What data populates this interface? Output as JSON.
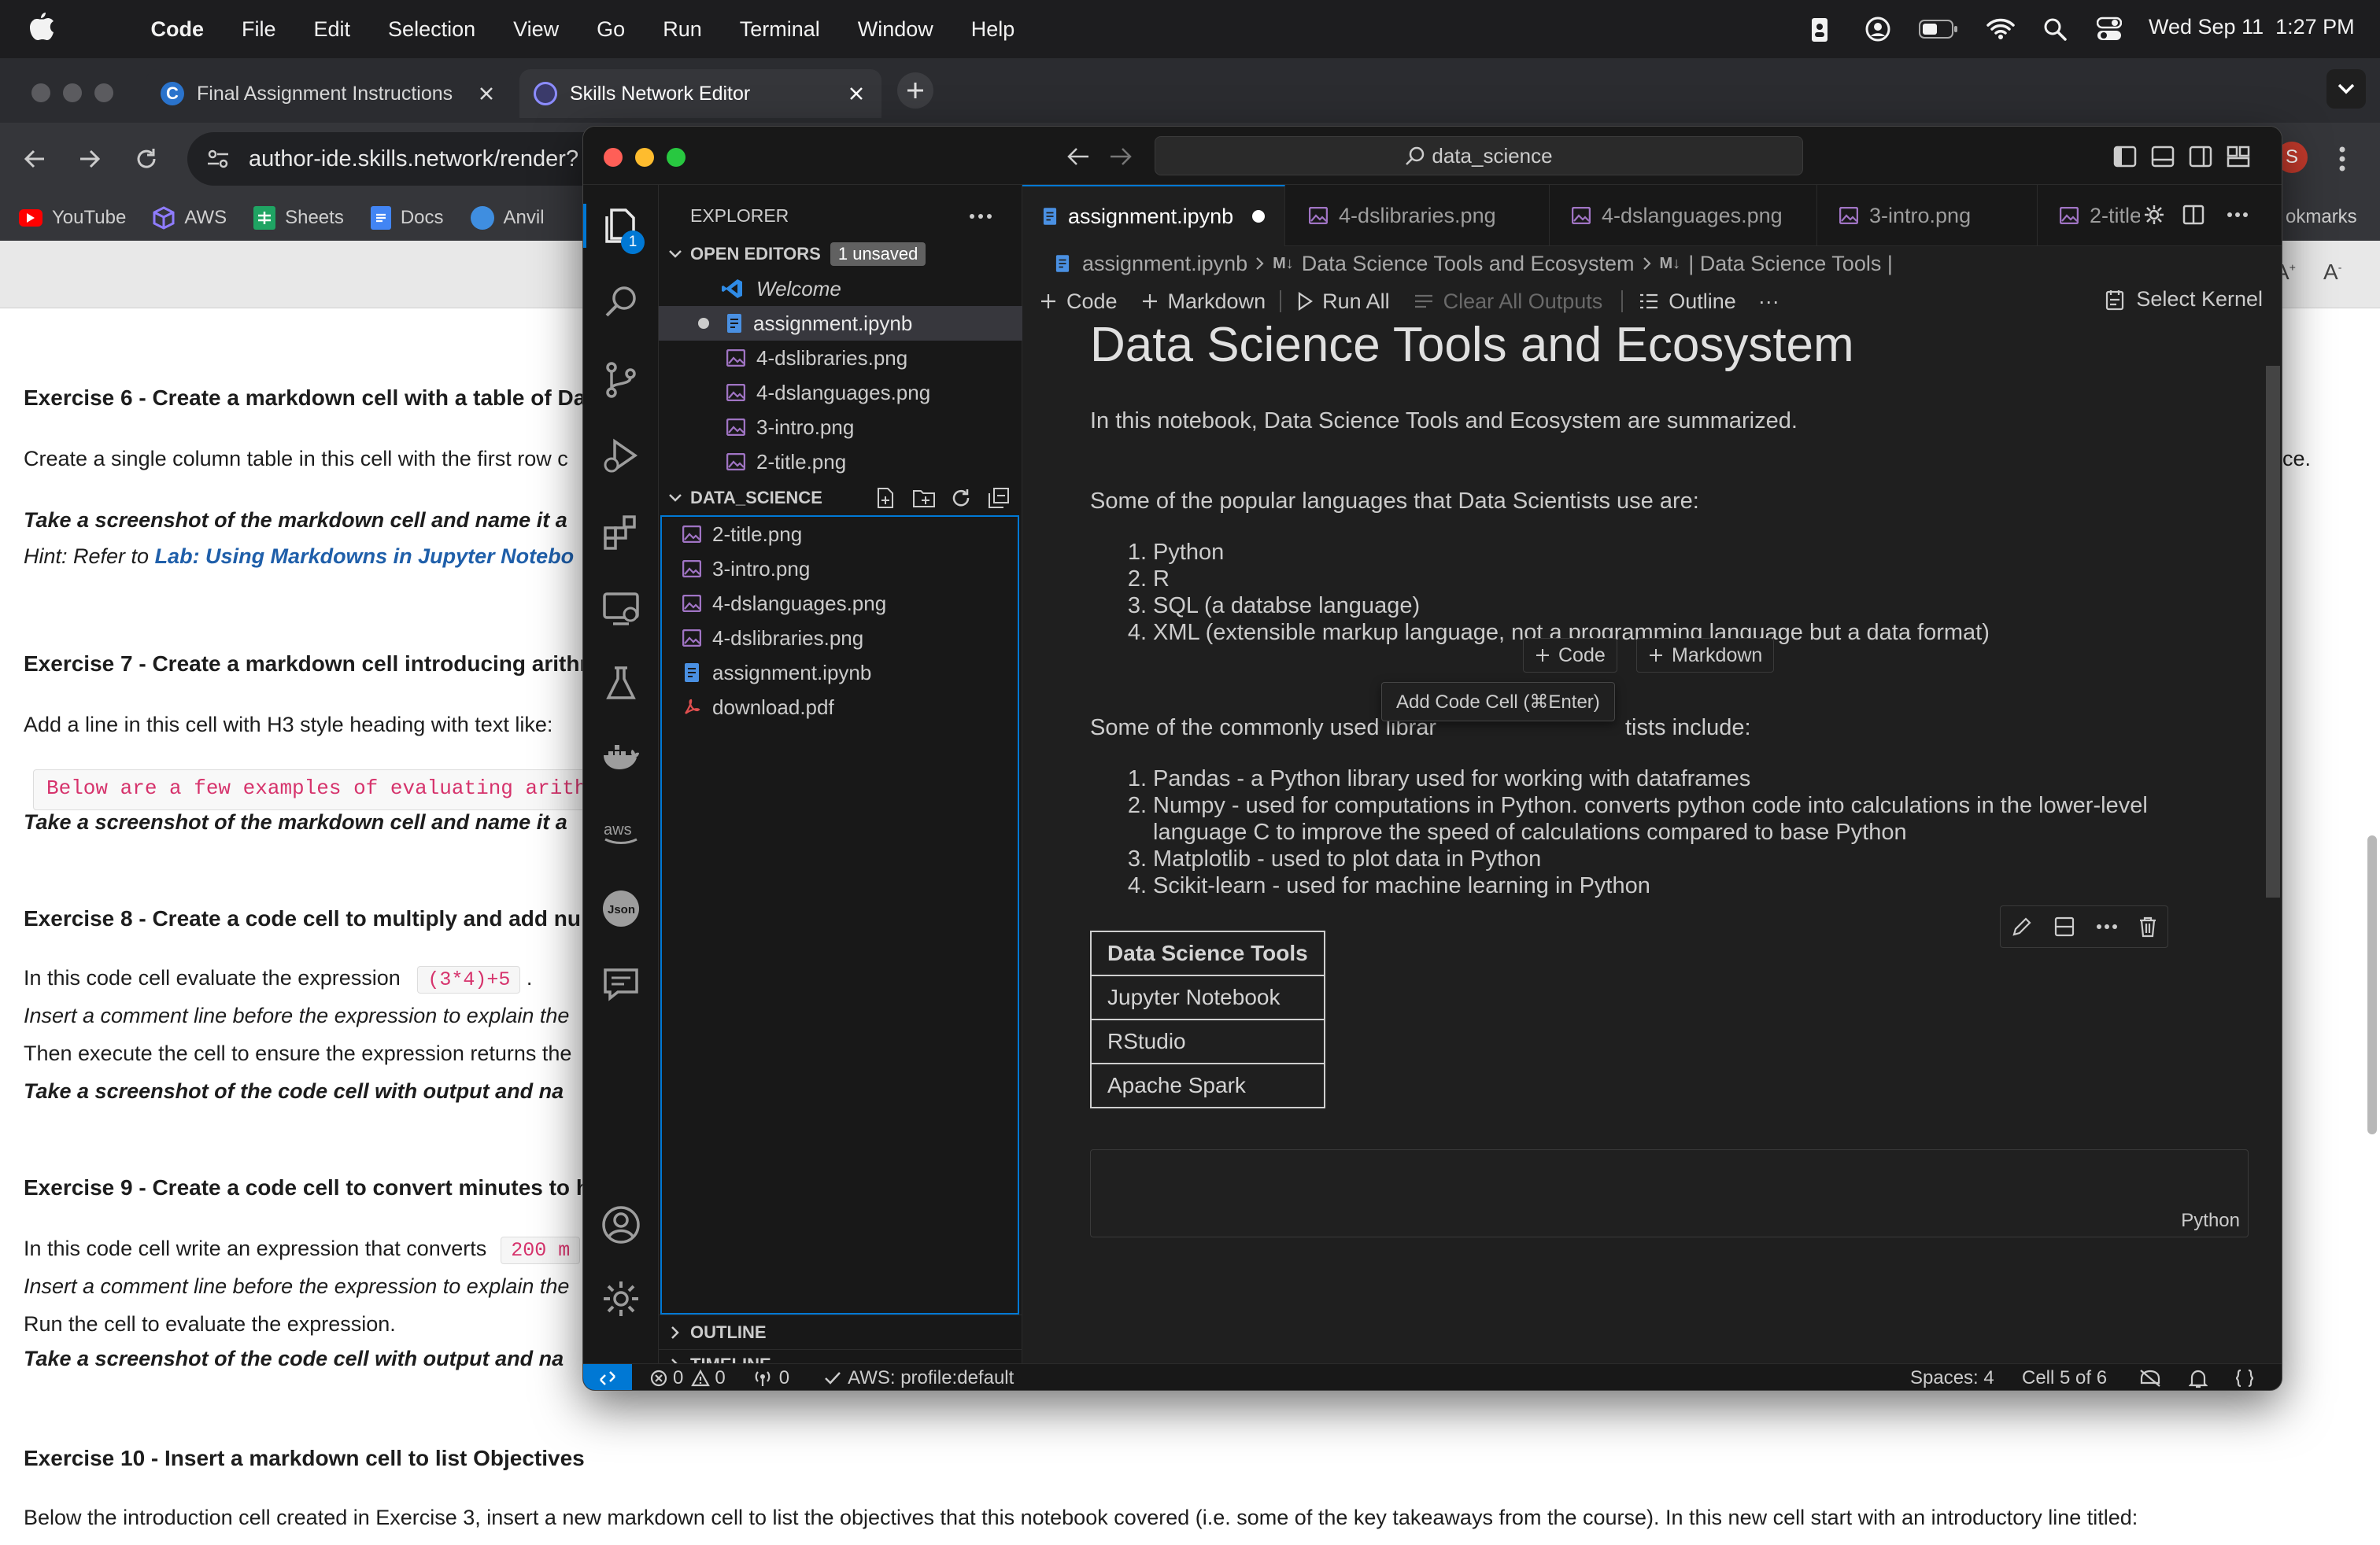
{
  "menubar": {
    "app": "Code",
    "items": [
      "File",
      "Edit",
      "Selection",
      "View",
      "Go",
      "Run",
      "Terminal",
      "Window",
      "Help"
    ],
    "datetime": "Wed Sep 11  1:27 PM"
  },
  "browser": {
    "tabs": [
      {
        "title": "Final Assignment Instructions"
      },
      {
        "title": "Skills Network Editor"
      }
    ],
    "url": "author-ide.skills.network/render?",
    "bookmarks": [
      "YouTube",
      "AWS",
      "Sheets",
      "Docs",
      "Anvil"
    ],
    "bookmarks_more": "okmarks"
  },
  "page": {
    "ex6_title": "Exercise 6 - Create a markdown cell with a table of Da",
    "ex6_text": "Create a single column table in this cell with the first row c",
    "ex6_text_end": "ce.",
    "ex6_screenshot": "Take a screenshot of the markdown cell and name it a",
    "ex6_hint_prefix": "Hint: Refer to ",
    "ex6_hint_link": "Lab: Using Markdowns in Jupyter Notebo",
    "ex7_title": "Exercise 7 - Create a markdown cell introducing arithr",
    "ex7_text": "Add a line in this cell with H3 style heading with text like:",
    "ex7_code": "Below are a few examples of evaluating arithm",
    "ex7_screenshot": "Take a screenshot of the markdown cell and name it a",
    "ex8_title": "Exercise 8 - Create a code cell to multiply and add nu",
    "ex8_text": "In this code cell evaluate the expression",
    "ex8_code": "(3*4)+5",
    "ex8_text_end": ".",
    "ex8_comment": "Insert a comment line before the expression to explain the",
    "ex8_run": "Then execute the cell to ensure the expression returns the",
    "ex8_screenshot": "Take a screenshot of the code cell with output and na",
    "ex9_title": "Exercise 9 - Create a code cell to convert minutes to h",
    "ex9_text": "In this code cell write an expression that converts",
    "ex9_code": "200 m",
    "ex9_comment": "Insert a comment line before the expression to explain the",
    "ex9_run": "Run the cell to evaluate the expression.",
    "ex9_screenshot": "Take a screenshot of the code cell with output and na",
    "ex10_title": "Exercise 10 - Insert a markdown cell to list Objectives",
    "ex10_text": "Below the introduction cell created in Exercise 3, insert a new markdown cell to list the objectives that this notebook covered (i.e. some of the key takeaways from the course). In this new cell start with an introductory line titled:"
  },
  "vscode": {
    "search": "data_science",
    "activity_badge": "1",
    "sidebar": {
      "title": "EXPLORER",
      "open_editors_label": "OPEN EDITORS",
      "unsaved_badge": "1 unsaved",
      "open_editors": [
        "Welcome",
        "assignment.ipynb",
        "4-dslibraries.png",
        "4-dslanguages.png",
        "3-intro.png",
        "2-title.png"
      ],
      "folder_label": "DATA_SCIENCE",
      "files": [
        "2-title.png",
        "3-intro.png",
        "4-dslanguages.png",
        "4-dslibraries.png",
        "assignment.ipynb",
        "download.pdf"
      ],
      "outline_label": "OUTLINE",
      "timeline_label": "TIMELINE"
    },
    "tabs": [
      "assignment.ipynb",
      "4-dslibraries.png",
      "4-dslanguages.png",
      "3-intro.png",
      "2-title"
    ],
    "breadcrumb": [
      "assignment.ipynb",
      "Data Science Tools and Ecosystem",
      "| Data Science Tools |"
    ],
    "md_badge": "M↓",
    "toolbar": {
      "code": "Code",
      "markdown": "Markdown",
      "run_all": "Run All",
      "clear_outputs": "Clear All Outputs",
      "outline": "Outline",
      "more": "···",
      "kernel": "Select Kernel"
    },
    "notebook": {
      "heading": "Data Science Tools and Ecosystem",
      "intro": "In this notebook, Data Science Tools and Ecosystem are summarized.",
      "languages_intro": "Some of the popular languages that Data Scientists use are:",
      "languages": [
        "Python",
        "R",
        "SQL (a databse language)",
        "XML (extensible markup language, not a programming language but a data format)"
      ],
      "libraries_intro_left": "Some of the commonly used librar",
      "libraries_intro_right": "tists include:",
      "libraries": [
        "Pandas - a Python library used for working with dataframes",
        "Numpy - used for computations in Python. converts python code into calculations in the lower-level",
        "Matplotlib - used to plot data in Python",
        "Scikit-learn - used for machine learning in Python"
      ],
      "libraries_wrap": "language C to improve the speed of calculations compared to base Python",
      "insert_code": "Code",
      "insert_markdown": "Markdown",
      "tooltip": "Add Code Cell (⌘Enter)",
      "table_header": "Data Science Tools",
      "table_rows": [
        "Jupyter Notebook",
        "RStudio",
        "Apache Spark"
      ],
      "cell_language": "Python"
    },
    "status": {
      "errors": "0",
      "warnings": "0",
      "ports": "0",
      "aws": "AWS: profile:default",
      "spaces": "Spaces: 4",
      "cell": "Cell 5 of 6"
    }
  }
}
